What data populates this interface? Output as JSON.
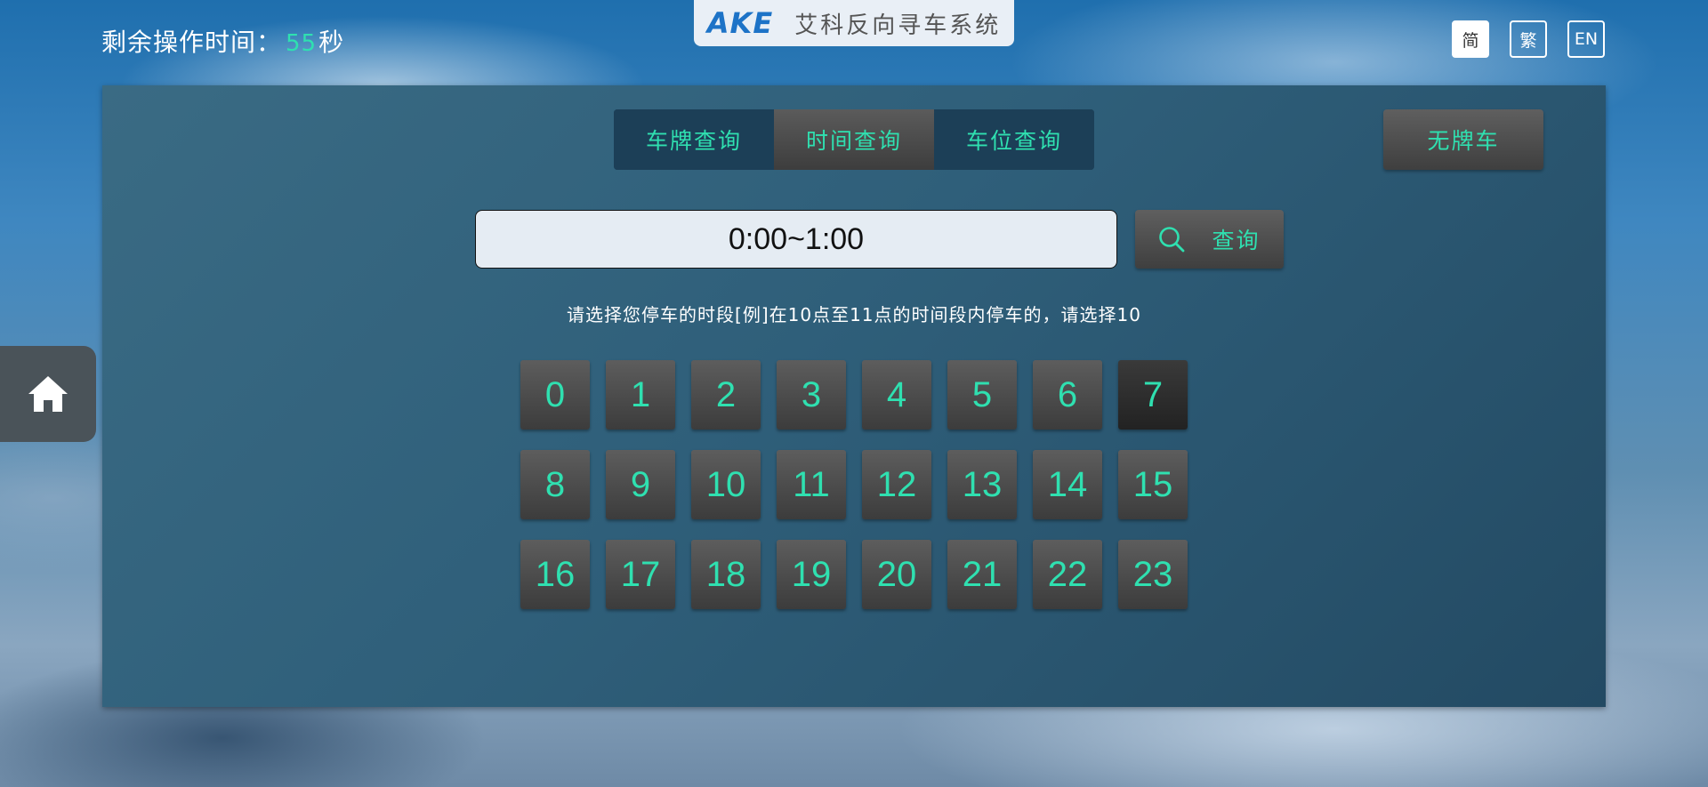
{
  "header": {
    "timer_label": "剩余操作时间：",
    "timer_seconds": "55",
    "timer_unit": "秒",
    "brand_logo": "AKE",
    "brand_name": "艾科反向寻车系统",
    "languages": [
      {
        "label": "简",
        "active": true
      },
      {
        "label": "繁",
        "active": false
      },
      {
        "label": "EN",
        "active": false
      }
    ]
  },
  "sidebar": {
    "home_icon": "home-icon"
  },
  "tabs": [
    {
      "label": "车牌查询",
      "active": false
    },
    {
      "label": "时间查询",
      "active": true
    },
    {
      "label": "车位查询",
      "active": false
    }
  ],
  "no_plate_button": "无牌车",
  "search": {
    "value": "0:00~1:00",
    "button_label": "查询",
    "button_icon": "search-icon"
  },
  "hint": "请选择您停车的时段[例]在10点至11点的时间段内停车的，请选择10",
  "hours": [
    "0",
    "1",
    "2",
    "3",
    "4",
    "5",
    "6",
    "7",
    "8",
    "9",
    "10",
    "11",
    "12",
    "13",
    "14",
    "15",
    "16",
    "17",
    "18",
    "19",
    "20",
    "21",
    "22",
    "23"
  ],
  "colors": {
    "accent": "#2fe0b0",
    "brand_blue": "#1d73c7",
    "panel": "#2f5f7a"
  }
}
